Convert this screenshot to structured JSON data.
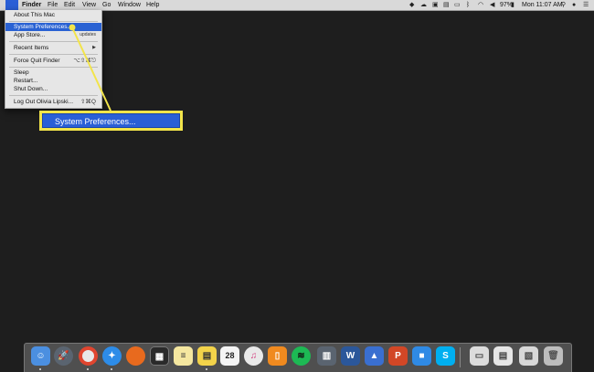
{
  "menubar": {
    "apple_icon": "apple-logo-icon",
    "app_name": "Finder",
    "menus": [
      "File",
      "Edit",
      "View",
      "Go",
      "Window",
      "Help"
    ],
    "battery_percent": "97%",
    "clock": "Mon 11:07 AM",
    "status_icons": [
      "dropbox-icon",
      "cloud-icon",
      "status-icon",
      "status-icon",
      "airplay-icon",
      "bluetooth-icon",
      "wifi-icon",
      "volume-icon",
      "battery-icon",
      "spotlight-icon",
      "user-icon",
      "notification-center-icon"
    ]
  },
  "apple_menu": {
    "about": "About This Mac",
    "system_preferences": "System Preferences...",
    "app_store": "App Store...",
    "app_store_badge": "updates",
    "recent_items": "Recent Items",
    "recent_items_arrow": "▶",
    "force_quit": "Force Quit Finder",
    "force_quit_shortcut": "⌥⇧⌘⎋",
    "sleep": "Sleep",
    "restart": "Restart...",
    "shut_down": "Shut Down...",
    "log_out": "Log Out Olivia Lipski...",
    "log_out_shortcut": "⇧⌘Q"
  },
  "callout": {
    "label": "System Preferences...",
    "color": "#f2e44a"
  },
  "dock": {
    "calendar_day": "28",
    "apps": [
      "finder-icon",
      "launchpad-icon",
      "chrome-icon",
      "safari-icon",
      "firefox-icon",
      "photo-booth-icon",
      "notes-icon",
      "stickies-icon",
      "calendar-icon",
      "itunes-icon",
      "books-icon",
      "spotify-icon",
      "word-icon",
      "keynote-icon",
      "powerpoint-icon",
      "facetime-icon",
      "skype-icon",
      "preview-icon",
      "downloads-folder-icon",
      "documents-folder-icon",
      "trash-icon"
    ]
  },
  "colors": {
    "highlight_blue": "#2a62d3",
    "desktop": "#1e1e1e",
    "callout_yellow": "#f2e44a"
  }
}
